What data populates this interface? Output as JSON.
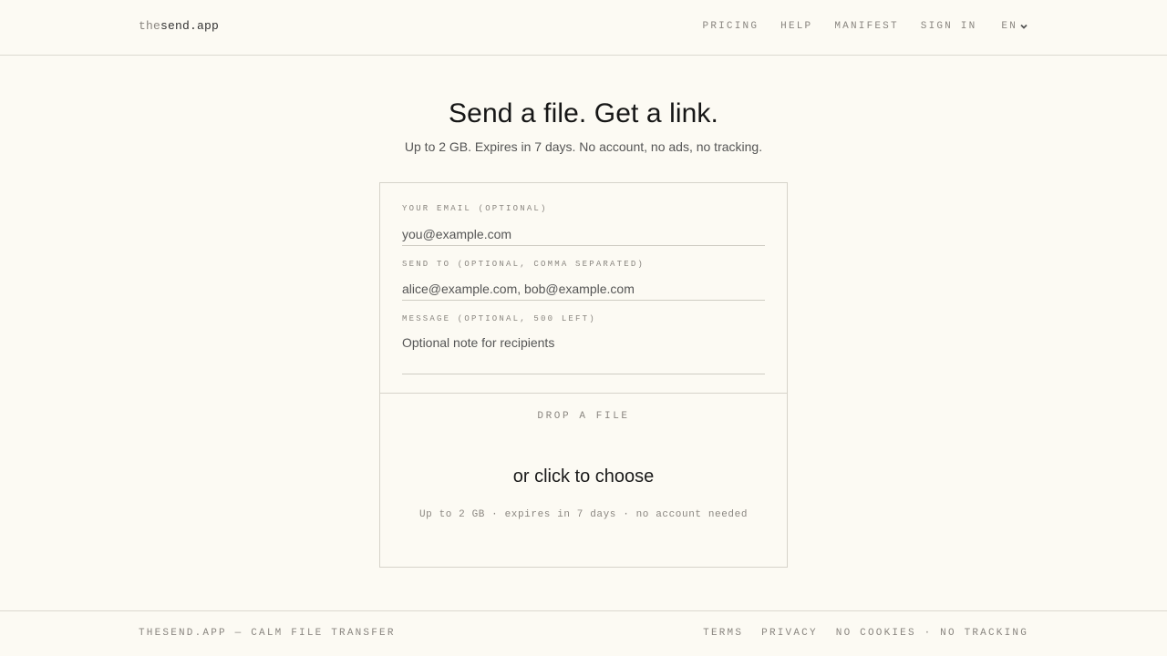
{
  "header": {
    "logo_prefix": "the",
    "logo_main": "send.app",
    "nav": {
      "pricing": "PRICING",
      "help": "HELP",
      "manifest": "MANIFEST",
      "sign_in": "SIGN IN",
      "language": "EN"
    }
  },
  "hero": {
    "title": "Send a file. Get a link.",
    "subtitle": "Up to 2 GB. Expires in 7 days. No account, no ads, no tracking."
  },
  "form": {
    "email": {
      "label": "YOUR EMAIL (OPTIONAL)",
      "placeholder": "you@example.com",
      "value": ""
    },
    "send_to": {
      "label": "SEND TO (OPTIONAL, COMMA SEPARATED)",
      "placeholder": "alice@example.com, bob@example.com",
      "value": ""
    },
    "message": {
      "label": "MESSAGE (OPTIONAL, 500 LEFT)",
      "placeholder": "Optional note for recipients",
      "value": ""
    }
  },
  "dropzone": {
    "kicker": "DROP A FILE",
    "cta": "or click to choose",
    "note": "Up to 2 GB · expires in 7 days · no account needed"
  },
  "footer": {
    "tagline": "THESEND.APP — CALM FILE TRANSFER",
    "links": {
      "terms": "TERMS",
      "privacy": "PRIVACY",
      "no_cookies": "NO COOKIES · NO TRACKING"
    }
  },
  "colors": {
    "background": "#fcfaf3",
    "muted_text": "#8a8680",
    "border": "#d6d3ca"
  }
}
